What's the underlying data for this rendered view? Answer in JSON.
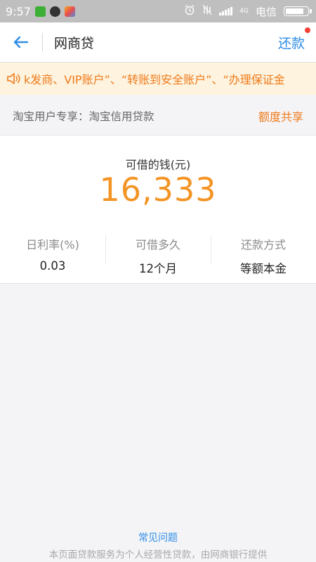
{
  "status_bar": {
    "time": "9:57",
    "carrier": "电信",
    "network": "4G",
    "icons": [
      "wechat-icon",
      "qq-icon",
      "photos-icon",
      "alarm-icon",
      "mute-icon",
      "signal-icon",
      "battery-icon"
    ],
    "battery_level": 0.85
  },
  "nav": {
    "back_icon": "arrow-left-icon",
    "title": "网商贷",
    "repay_label": "还款",
    "has_badge": true
  },
  "notice": {
    "icon": "speaker-icon",
    "text": "k发商、VIP账户”、“转账到安全账户”、“办理保证金"
  },
  "subtitle": {
    "text": "淘宝用户专享：淘宝信用贷款",
    "quota_share_label": "额度共享"
  },
  "loan": {
    "available_label": "可借的钱(元)",
    "amount": "16,333",
    "stats": [
      {
        "label": "日利率(%)",
        "value": "0.03"
      },
      {
        "label": "可借多久",
        "value": "12个月"
      },
      {
        "label": "还款方式",
        "value": "等额本金"
      }
    ]
  },
  "footer": {
    "faq_label": "常见问题",
    "disclaimer": "本页面贷款服务为个人经营性贷款，由网商银行提供"
  },
  "colors": {
    "accent_blue": "#2f8ee6",
    "accent_orange": "#f07a1a",
    "amount_orange": "#f39424",
    "notice_bg": "#fdf3de",
    "status_bar_bg": "#bfbfbf"
  }
}
